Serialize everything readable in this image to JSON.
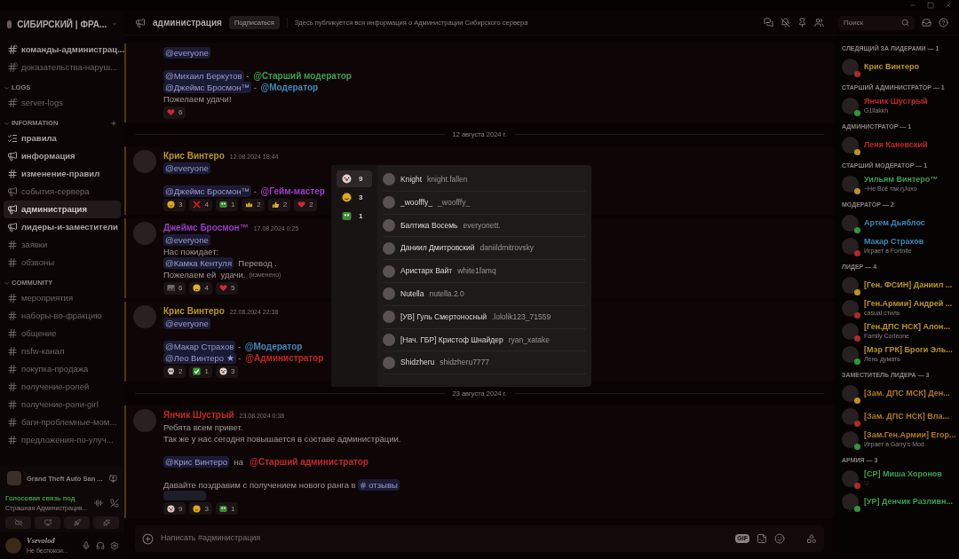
{
  "server": {
    "name": "СИБИРСКИЙ | ФРА..."
  },
  "channels": [
    {
      "items": [
        {
          "name": "команды-администрац...",
          "kind": "locked",
          "unread": true,
          "selected": false
        },
        {
          "name": "доказательства-наруш...",
          "kind": "locked",
          "unread": false,
          "selected": false
        }
      ]
    },
    {
      "category": "LOGS",
      "items": [
        {
          "name": "server-logs",
          "kind": "locked",
          "unread": false,
          "selected": false
        }
      ]
    },
    {
      "category": "INFORMATION",
      "add": true,
      "items": [
        {
          "name": "правила",
          "kind": "rules",
          "unread": true,
          "selected": false
        },
        {
          "name": "информация",
          "kind": "announcement",
          "unread": true,
          "selected": false
        },
        {
          "name": "изменение-правил",
          "kind": "text",
          "unread": true,
          "selected": false
        },
        {
          "name": "события-сервера",
          "kind": "announcement",
          "unread": false,
          "selected": false
        },
        {
          "name": "администрация",
          "kind": "announcement",
          "unread": true,
          "selected": true
        },
        {
          "name": "лидеры-и-заместители",
          "kind": "announcement",
          "unread": true,
          "selected": false
        },
        {
          "name": "заявки",
          "kind": "text",
          "unread": false,
          "selected": false
        },
        {
          "name": "обзвоны",
          "kind": "text",
          "unread": false,
          "selected": false
        }
      ]
    },
    {
      "category": "COMMUNITY",
      "items": [
        {
          "name": "мероприятия",
          "kind": "text",
          "unread": false,
          "selected": false
        },
        {
          "name": "наборы-во-фракцию",
          "kind": "text",
          "unread": false,
          "selected": false
        },
        {
          "name": "общение",
          "kind": "text",
          "unread": false,
          "selected": false
        },
        {
          "name": "nsfw-канал",
          "kind": "text",
          "unread": false,
          "selected": false
        },
        {
          "name": "покупка-продажа",
          "kind": "text",
          "unread": false,
          "selected": false
        },
        {
          "name": "получение-ролей",
          "kind": "text",
          "unread": false,
          "selected": false
        },
        {
          "name": "получение-роли-girl",
          "kind": "text",
          "unread": false,
          "selected": false
        },
        {
          "name": "баги-проблемные-мом...",
          "kind": "text",
          "unread": false,
          "selected": false
        },
        {
          "name": "предложения-по-улуч...",
          "kind": "text",
          "unread": false,
          "selected": false
        }
      ]
    }
  ],
  "activity": {
    "game": "Grand Theft Auto San ..."
  },
  "voice": {
    "status": "Голосовая связь под",
    "channel": "Страшная Администрация..."
  },
  "user": {
    "name": "Vsevolod",
    "status": "Не беспокои..."
  },
  "header": {
    "channel": "администрация",
    "follow_button": "Подписаться",
    "topic": "Здесь публикуется вся информация о Администрации Сибирского сервера",
    "search_placeholder": "Поиск"
  },
  "messages": [
    {
      "kind": "continuation",
      "lines": [
        {
          "segments": [
            {
              "kind": "mention",
              "s": "@everyone"
            }
          ]
        },
        {
          "gap": true,
          "segments": [
            {
              "kind": "mention",
              "s": "@Михаил Беркутов"
            },
            {
              "kind": "text",
              "s": " - "
            },
            {
              "kind": "role",
              "s": "@Старший модератор",
              "color": "#3aa050"
            }
          ]
        },
        {
          "segments": [
            {
              "kind": "mention",
              "s": "@Джеймс Бросмон™"
            },
            {
              "kind": "text",
              "s": " - "
            },
            {
              "kind": "role",
              "s": "@Модератор",
              "color": "#3a8ab8"
            }
          ]
        },
        {
          "segments": [
            {
              "kind": "text",
              "s": "Пожелаем удачи!"
            }
          ]
        }
      ],
      "reactions": [
        {
          "kind": "heart",
          "count": "6"
        }
      ]
    },
    {
      "kind": "date",
      "text": "12 августа 2024 г."
    },
    {
      "kind": "message",
      "author": "Крис Винтеро",
      "color": "#b8961e",
      "time": "12.08.2024 18:44",
      "lines": [
        {
          "segments": [
            {
              "kind": "mention",
              "s": "@everyone"
            }
          ]
        },
        {
          "gap": true,
          "segments": [
            {
              "kind": "mention",
              "s": "@Джеймс Бросмон™"
            },
            {
              "kind": "text",
              "s": " - "
            },
            {
              "kind": "role",
              "s": "@Гейм-мастер",
              "color": "#9a3ac8"
            }
          ]
        }
      ],
      "reactions": [
        {
          "kind": "rofl",
          "count": "3"
        },
        {
          "kind": "cross",
          "count": "4"
        },
        {
          "kind": "pepe",
          "count": "1"
        },
        {
          "kind": "crown",
          "count": "2"
        },
        {
          "kind": "thumbs",
          "count": "2"
        },
        {
          "kind": "heart",
          "count": "2"
        }
      ]
    },
    {
      "kind": "message",
      "author": "Джеймс Бросмон™",
      "color": "#9a3ac8",
      "time": "17.08.2024 0:25",
      "lines": [
        {
          "segments": [
            {
              "kind": "mention",
              "s": "@everyone"
            }
          ]
        },
        {
          "segments": [
            {
              "kind": "text",
              "s": "Нас покидает:"
            }
          ]
        },
        {
          "segments": [
            {
              "kind": "mention",
              "s": "@Камка Кентуля"
            },
            {
              "kind": "text",
              "s": "  Перевод ."
            }
          ]
        },
        {
          "segments": [
            {
              "kind": "text",
              "s": "Пожелаем ей  удачи."
            },
            {
              "kind": "edited",
              "s": "(изменено)"
            }
          ]
        }
      ],
      "reactions": [
        {
          "kind": "sticker",
          "count": "6"
        },
        {
          "kind": "sad",
          "count": "4"
        },
        {
          "kind": "heart",
          "count": "5"
        }
      ]
    },
    {
      "kind": "message",
      "author": "Крис Винтеро",
      "color": "#b8961e",
      "time": "22.08.2024 22:38",
      "lines": [
        {
          "segments": [
            {
              "kind": "mention",
              "s": "@everyone"
            }
          ]
        },
        {
          "gap": true,
          "segments": [
            {
              "kind": "mention",
              "s": "@Макар Страхов"
            },
            {
              "kind": "text",
              "s": " - "
            },
            {
              "kind": "role",
              "s": "@Модератор",
              "color": "#3a8ab8"
            }
          ]
        },
        {
          "segments": [
            {
              "kind": "mention",
              "s": "@Лео Винтеро ★"
            },
            {
              "kind": "text",
              "s": " - "
            },
            {
              "kind": "role",
              "s": "@Администратор",
              "color": "#c02828"
            }
          ]
        }
      ],
      "reactions": [
        {
          "kind": "skull",
          "count": "2"
        },
        {
          "kind": "check",
          "count": "1"
        },
        {
          "kind": "clown",
          "count": "3"
        }
      ]
    },
    {
      "kind": "date",
      "text": "23 августа 2024 г."
    },
    {
      "kind": "message",
      "author": "Янчик Шустрый",
      "color": "#c02828",
      "time": "23.08.2024 0:38",
      "spoiler": true,
      "lines": [
        {
          "segments": [
            {
              "kind": "text",
              "s": "Ребята всем привет."
            }
          ]
        },
        {
          "segments": [
            {
              "kind": "text",
              "s": "Так же у нас сегодня повышается в составе администрации."
            }
          ]
        },
        {
          "gap": true,
          "segments": [
            {
              "kind": "mention",
              "s": "@Крис Винтеро"
            },
            {
              "kind": "text",
              "s": "  на  "
            },
            {
              "kind": "role",
              "s": "@Старший администратор",
              "color": "#c02828"
            }
          ]
        },
        {
          "gap": true,
          "segments": [
            {
              "kind": "text",
              "s": "Давайте поздравим с получением нового ранга в "
            },
            {
              "kind": "channel",
              "s": "отзывы"
            }
          ]
        }
      ],
      "reactions": [
        {
          "kind": "clown",
          "count": "9"
        },
        {
          "kind": "rofl",
          "count": "3"
        },
        {
          "kind": "pepe",
          "count": "1"
        }
      ]
    }
  ],
  "composer": {
    "placeholder": "Написать #администрация",
    "gif": "GIF"
  },
  "reactions_popup": {
    "tabs": [
      {
        "kind": "clown",
        "count": "9",
        "selected": true
      },
      {
        "kind": "rofl",
        "count": "3",
        "selected": false
      },
      {
        "kind": "pepe",
        "count": "1",
        "selected": false
      }
    ],
    "users": [
      {
        "name": "Knight",
        "username": "knight.fallen"
      },
      {
        "name": "_woofffy_",
        "username": "_woofffy_"
      },
      {
        "name": "Балтика Восемь",
        "username": "everyonett."
      },
      {
        "name": "Даниил Дмитровский",
        "username": "daniildmitrovsky"
      },
      {
        "name": "Аристарх Вайт",
        "username": "white1famq"
      },
      {
        "name": "Nutella",
        "username": "nutella.2.0"
      },
      {
        "name": "[УВ] Гуль Смертоносный",
        "username": ".lololik123_71559"
      },
      {
        "name": "[Нач. ГБР] Кристоф Шнайдер",
        "username": "ryan_xatake"
      },
      {
        "name": "Shidzheru",
        "username": "shidzheru7777"
      }
    ]
  },
  "members": [
    {
      "group": "СЛЕДЯЩИЙ ЗА ЛИДЕРАМИ — 1",
      "items": [
        {
          "name": "Крис Винтеро",
          "color": "#b8961e",
          "kind": "dnd"
        }
      ]
    },
    {
      "group": "СТАРШИЙ АДМИНИСТРАТОР — 1",
      "items": [
        {
          "name": "Янчик Шустрый",
          "color": "#c02828",
          "kind": "online",
          "activity": "G1llakkh"
        }
      ]
    },
    {
      "group": "АДМИНИСТРАТОР — 1",
      "items": [
        {
          "name": "Леня Каневский",
          "color": "#c02828",
          "kind": "idle"
        }
      ]
    },
    {
      "group": "СТАРШИЙ МОДЕРАТОР — 1",
      "items": [
        {
          "name": "Уильям Винтеро™",
          "color": "#3aa050",
          "kind": "idle",
          "activity": "~Не Всё так ŋJoxo"
        }
      ]
    },
    {
      "group": "МОДЕРАТОР — 2",
      "items": [
        {
          "name": "Артем Дьяблос",
          "color": "#3a8ab8",
          "kind": "online"
        },
        {
          "name": "Макар Страхов",
          "color": "#3a8ab8",
          "kind": "dnd",
          "activity": "Играет в Fortnite"
        }
      ]
    },
    {
      "group": "ЛИДЕР — 4",
      "items": [
        {
          "name": "[Ген. ФСИН] Даниил ...",
          "color": "#b8961e",
          "kind": "idle"
        },
        {
          "name": "[Ген.Армии] Андрей ...",
          "color": "#b8961e",
          "kind": "dnd",
          "activity": "casual стиль"
        },
        {
          "name": "[Ген.ДПС НСК] Алон...",
          "color": "#b8961e",
          "kind": "dnd",
          "activity": "Family Corleone"
        },
        {
          "name": "[Мэр ГРК] Броги Эль...",
          "color": "#b8961e",
          "kind": "online",
          "activity": "Лень думать"
        }
      ]
    },
    {
      "group": "ЗАМЕСТИТЕЛЬ ЛИДЕРА — 3",
      "items": [
        {
          "name": "[Зам. ДПС МСК] Ден...",
          "color": "#b07a18",
          "kind": "idle"
        },
        {
          "name": "[Зам. ДПС НСК] Вла...",
          "color": "#b07a18",
          "kind": "dnd"
        },
        {
          "name": "[Зам.Ген.Армии] Егор...",
          "color": "#b07a18",
          "kind": "online",
          "activity": "Играет в Garry's Mod"
        }
      ]
    },
    {
      "group": "АРМИЯ — 3",
      "items": [
        {
          "name": "[СР] Миша Хоронов",
          "color": "#3aa050",
          "kind": "dnd",
          "activity": "♡"
        },
        {
          "name": "[УР] Денчик Разливн...",
          "color": "#3aa050",
          "kind": "online"
        }
      ]
    }
  ]
}
